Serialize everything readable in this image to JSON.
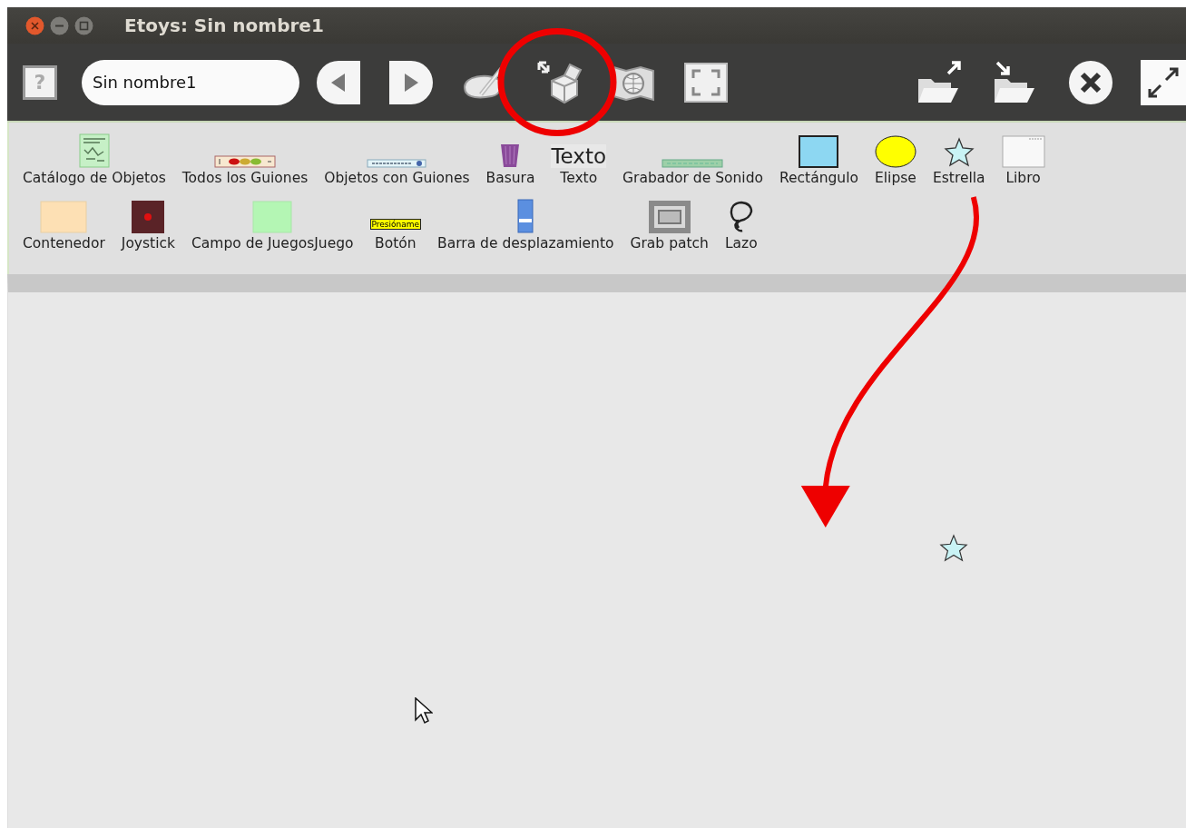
{
  "window": {
    "title": "Etoys: Sin nombre1"
  },
  "toolbar": {
    "project_name": "Sin nombre1",
    "buttons": [
      {
        "kind": "help",
        "label": "?"
      },
      {
        "kind": "field"
      },
      {
        "kind": "prev"
      },
      {
        "kind": "next"
      },
      {
        "kind": "paint"
      },
      {
        "kind": "supplies"
      },
      {
        "kind": "language"
      },
      {
        "kind": "fullscreen"
      },
      {
        "kind": "open"
      },
      {
        "kind": "save"
      },
      {
        "kind": "close"
      },
      {
        "kind": "maximize"
      }
    ]
  },
  "supplies": {
    "row_1": [
      {
        "kind": "catalog",
        "label": "Catálogo de Objetos"
      },
      {
        "kind": "scripts",
        "label": "Todos los Guiones"
      },
      {
        "kind": "scripted",
        "label": "Objetos con Guiones"
      },
      {
        "kind": "trash",
        "label": "Basura"
      },
      {
        "kind": "text",
        "label": "Texto",
        "preview": "Texto"
      },
      {
        "kind": "sound",
        "label": "Grabador de Sonido"
      },
      {
        "kind": "rect",
        "label": "Rectángulo"
      },
      {
        "kind": "ellipse",
        "label": "Elipse"
      },
      {
        "kind": "star",
        "label": "Estrella",
        "arrow": true
      },
      {
        "kind": "book",
        "label": "Libro"
      }
    ],
    "row_2": [
      {
        "kind": "holder",
        "label": "Contenedor"
      },
      {
        "kind": "joystick",
        "label": "Joystick"
      },
      {
        "kind": "playfield",
        "label": "Campo de JuegosJuego"
      },
      {
        "kind": "button",
        "label": "Botón",
        "preview": "Presióname"
      },
      {
        "kind": "scrollbar",
        "label": "Barra de desplazamiento"
      },
      {
        "kind": "grabpatch",
        "label": "Grab patch"
      },
      {
        "kind": "lasso",
        "label": "Lazo"
      }
    ]
  }
}
